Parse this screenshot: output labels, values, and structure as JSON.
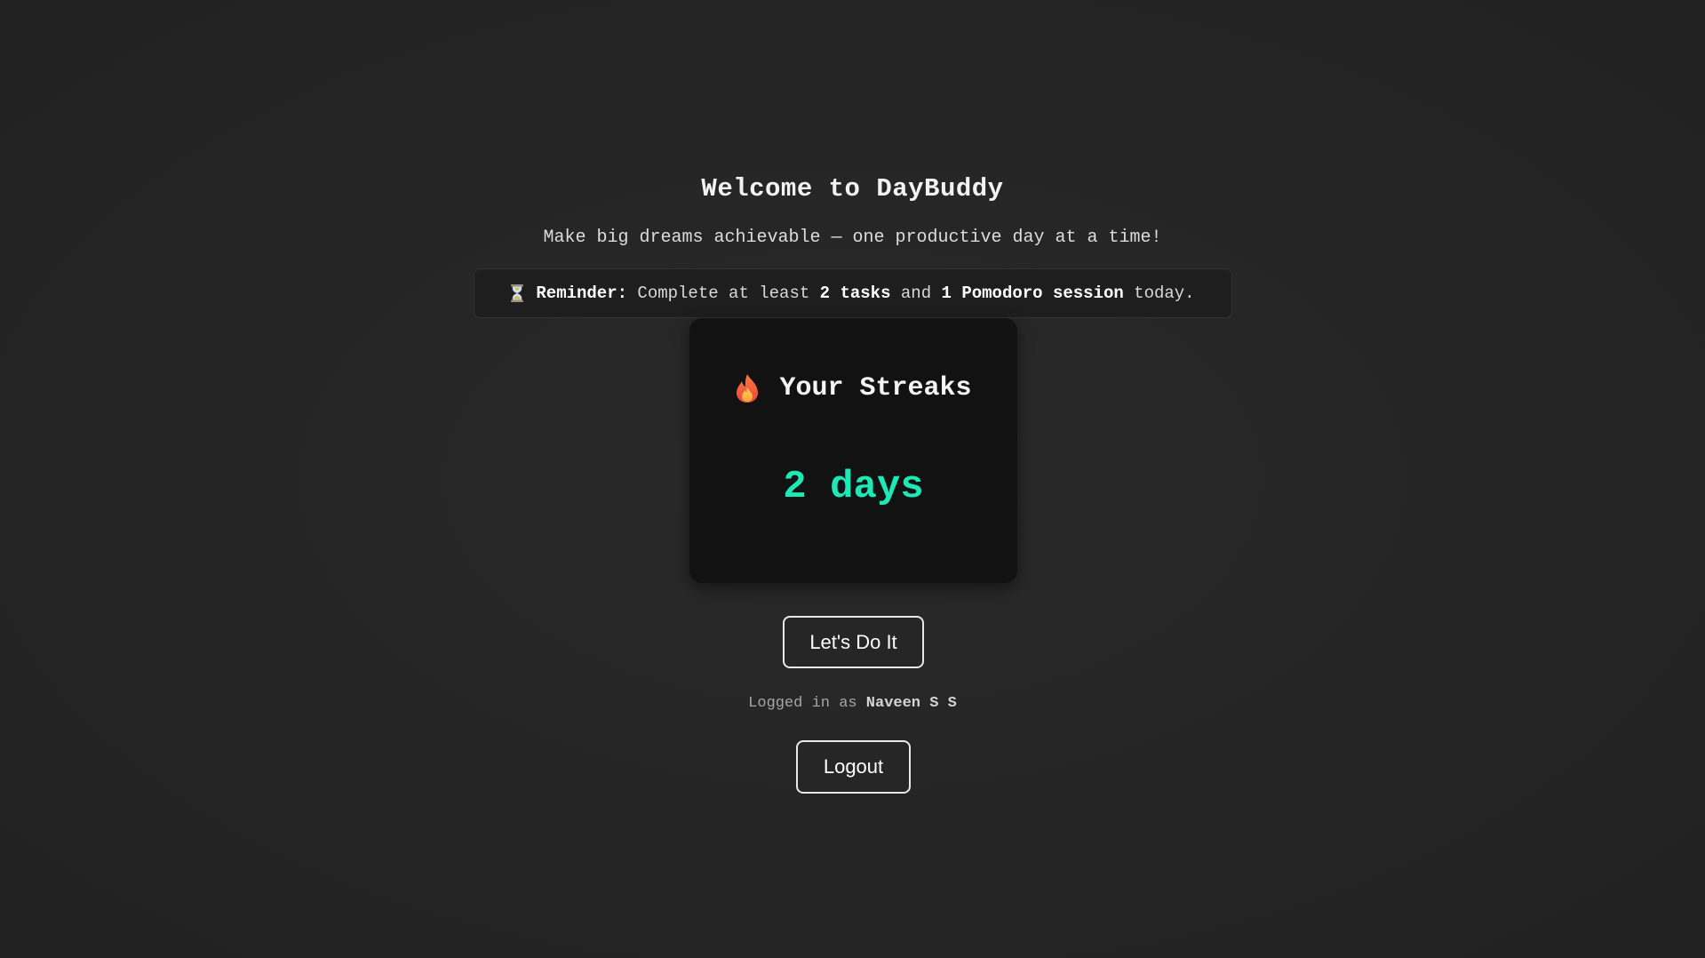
{
  "header": {
    "title": "Welcome to DayBuddy",
    "tagline": "Make big dreams achievable — one productive day at a time!"
  },
  "reminder": {
    "icon": "hourglass-icon",
    "label": "Reminder:",
    "text_1": "Complete at least",
    "tasks": "2 tasks",
    "text_2": "and",
    "pomodoro": "1 Pomodoro session",
    "text_3": "today."
  },
  "streak": {
    "icon": "flame-icon",
    "title": "Your Streaks",
    "value": "2 days",
    "value_color": "#1de9b6"
  },
  "actions": {
    "start_label": "Let's Do It",
    "logout_label": "Logout"
  },
  "user": {
    "prefix": "Logged in as",
    "name": "Naveen S S"
  }
}
